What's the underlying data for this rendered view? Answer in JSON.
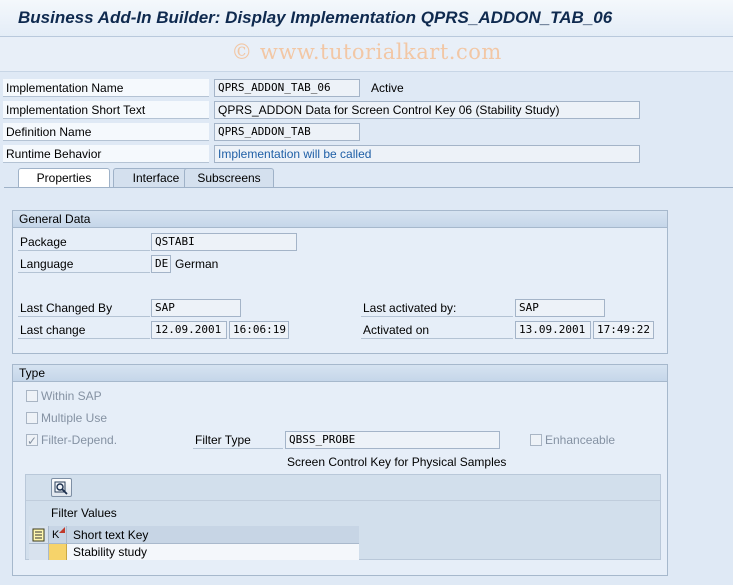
{
  "window": {
    "title": "Business Add-In Builder: Display Implementation QPRS_ADDON_TAB_06"
  },
  "watermark": "© www.tutorialkart.com",
  "header": {
    "impl_name_label": "Implementation Name",
    "impl_name_value": "QPRS_ADDON_TAB_06",
    "impl_status": "Active",
    "short_text_label": "Implementation Short Text",
    "short_text_value": "QPRS_ADDON Data for Screen Control Key 06 (Stability Study)",
    "def_name_label": "Definition Name",
    "def_name_value": "QPRS_ADDON_TAB",
    "runtime_label": "Runtime Behavior",
    "runtime_value": "Implementation will be called"
  },
  "tabs": [
    {
      "label": "Properties",
      "active": true
    },
    {
      "label": "Interface",
      "active": false
    },
    {
      "label": "Subscreens",
      "active": false
    }
  ],
  "general": {
    "title": "General Data",
    "package_label": "Package",
    "package_value": "QSTABI",
    "language_label": "Language",
    "language_code": "DE",
    "language_name": "German",
    "changed_by_label": "Last Changed By",
    "changed_by_value": "SAP",
    "last_change_label": "Last change",
    "last_change_date": "12.09.2001",
    "last_change_time": "16:06:19",
    "activated_by_label": "Last activated by:",
    "activated_by_value": "SAP",
    "activated_on_label": "Activated on",
    "activated_on_date": "13.09.2001",
    "activated_on_time": "17:49:22"
  },
  "type": {
    "title": "Type",
    "within_sap": {
      "label": "Within SAP",
      "checked": false
    },
    "multiple_use": {
      "label": "Multiple Use",
      "checked": false
    },
    "filter_depend": {
      "label": "Filter-Depend.",
      "checked": true
    },
    "enhanceable": {
      "label": "Enhanceable",
      "checked": false
    },
    "filter_type_label": "Filter Type",
    "filter_type_value": "QBSS_PROBE",
    "filter_type_desc": "Screen Control Key for Physical Samples"
  },
  "filter_values": {
    "title": "Filter Values",
    "col_key": "K",
    "col_text": "Short text Key",
    "rows": [
      {
        "text": "Stability study"
      }
    ]
  },
  "colors": {
    "background": "#dfe9f5",
    "title": "#0f2a4f",
    "link": "#1f5fa6"
  }
}
